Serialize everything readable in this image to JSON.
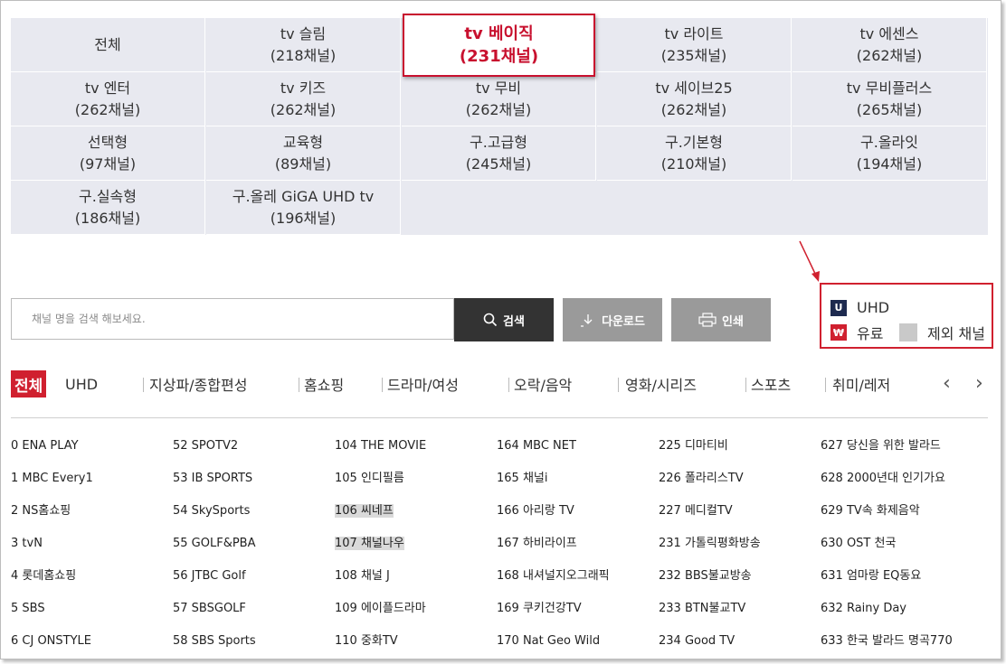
{
  "packages": [
    {
      "name": "전체",
      "count": ""
    },
    {
      "name": "tv 슬림",
      "count": "(218채널)"
    },
    {
      "name": "tv 베이직",
      "count": "(231채널)",
      "selected": true
    },
    {
      "name": "tv 라이트",
      "count": "(235채널)"
    },
    {
      "name": "tv 에센스",
      "count": "(262채널)"
    },
    {
      "name": "tv 엔터",
      "count": "(262채널)"
    },
    {
      "name": "tv 키즈",
      "count": "(262채널)"
    },
    {
      "name": "tv 무비",
      "count": "(262채널)"
    },
    {
      "name": "tv 세이브25",
      "count": "(262채널)"
    },
    {
      "name": "tv 무비플러스",
      "count": "(265채널)"
    },
    {
      "name": "선택형",
      "count": "(97채널)"
    },
    {
      "name": "교육형",
      "count": "(89채널)"
    },
    {
      "name": "구.고급형",
      "count": "(245채널)"
    },
    {
      "name": "구.기본형",
      "count": "(210채널)"
    },
    {
      "name": "구.올라잇",
      "count": "(194채널)"
    },
    {
      "name": "구.실속형",
      "count": "(186채널)"
    },
    {
      "name": "구.올레 GiGA UHD tv",
      "count": "(196채널)"
    }
  ],
  "search": {
    "placeholder": "채널 명을 검색 해보세요.",
    "search_label": "검색",
    "download_label": "다운로드",
    "print_label": "인쇄"
  },
  "legend": {
    "uhd_badge": "U",
    "uhd_label": "UHD",
    "paid_badge": "₩",
    "paid_label": "유료",
    "excluded_label": "제외 채널",
    "colors": {
      "uhd": "#1d2a4f",
      "paid": "#d0202f",
      "excluded": "#c9c9c9"
    }
  },
  "tabs": [
    "전체",
    "UHD",
    "지상파/종합편성",
    "홈쇼핑",
    "드라마/여성",
    "오락/음악",
    "영화/시리즈",
    "스포츠",
    "취미/레저"
  ],
  "channels": [
    [
      "0 ENA PLAY",
      "1 MBC Every1",
      "2 NS홈쇼핑",
      "3 tvN",
      "4 롯데홈쇼핑",
      "5 SBS",
      "6 CJ ONSTYLE"
    ],
    [
      "52 SPOTV2",
      "53 IB SPORTS",
      "54 SkySports",
      "55 GOLF&PBA",
      "56 JTBC Golf",
      "57 SBSGOLF",
      "58 SBS Sports"
    ],
    [
      "104 THE MOVIE",
      "105 인디필름",
      "106 씨네프",
      "107 채널나우",
      "108 채널 J",
      "109 에이플드라마",
      "110 중화TV"
    ],
    [
      "164 MBC NET",
      "165 채널i",
      "166 아리랑 TV",
      "167 하비라이프",
      "168 내셔널지오그래픽",
      "169 쿠키건강TV",
      "170 Nat Geo Wild"
    ],
    [
      "225 디마티비",
      "226 폴라리스TV",
      "227 메디컬TV",
      "231 가톨릭평화방송",
      "232 BBS불교방송",
      "233 BTN불교TV",
      "234 Good TV"
    ],
    [
      "627 당신을 위한 발라드",
      "628 2000년대 인기가요",
      "629 TV속 화제음악",
      "630 OST 천국",
      "631 엄마랑 EQ동요",
      "632 Rainy Day",
      "633 한국 발라드 명곡770"
    ]
  ],
  "excluded_channels": [
    "106 씨네프",
    "107 채널나우"
  ]
}
